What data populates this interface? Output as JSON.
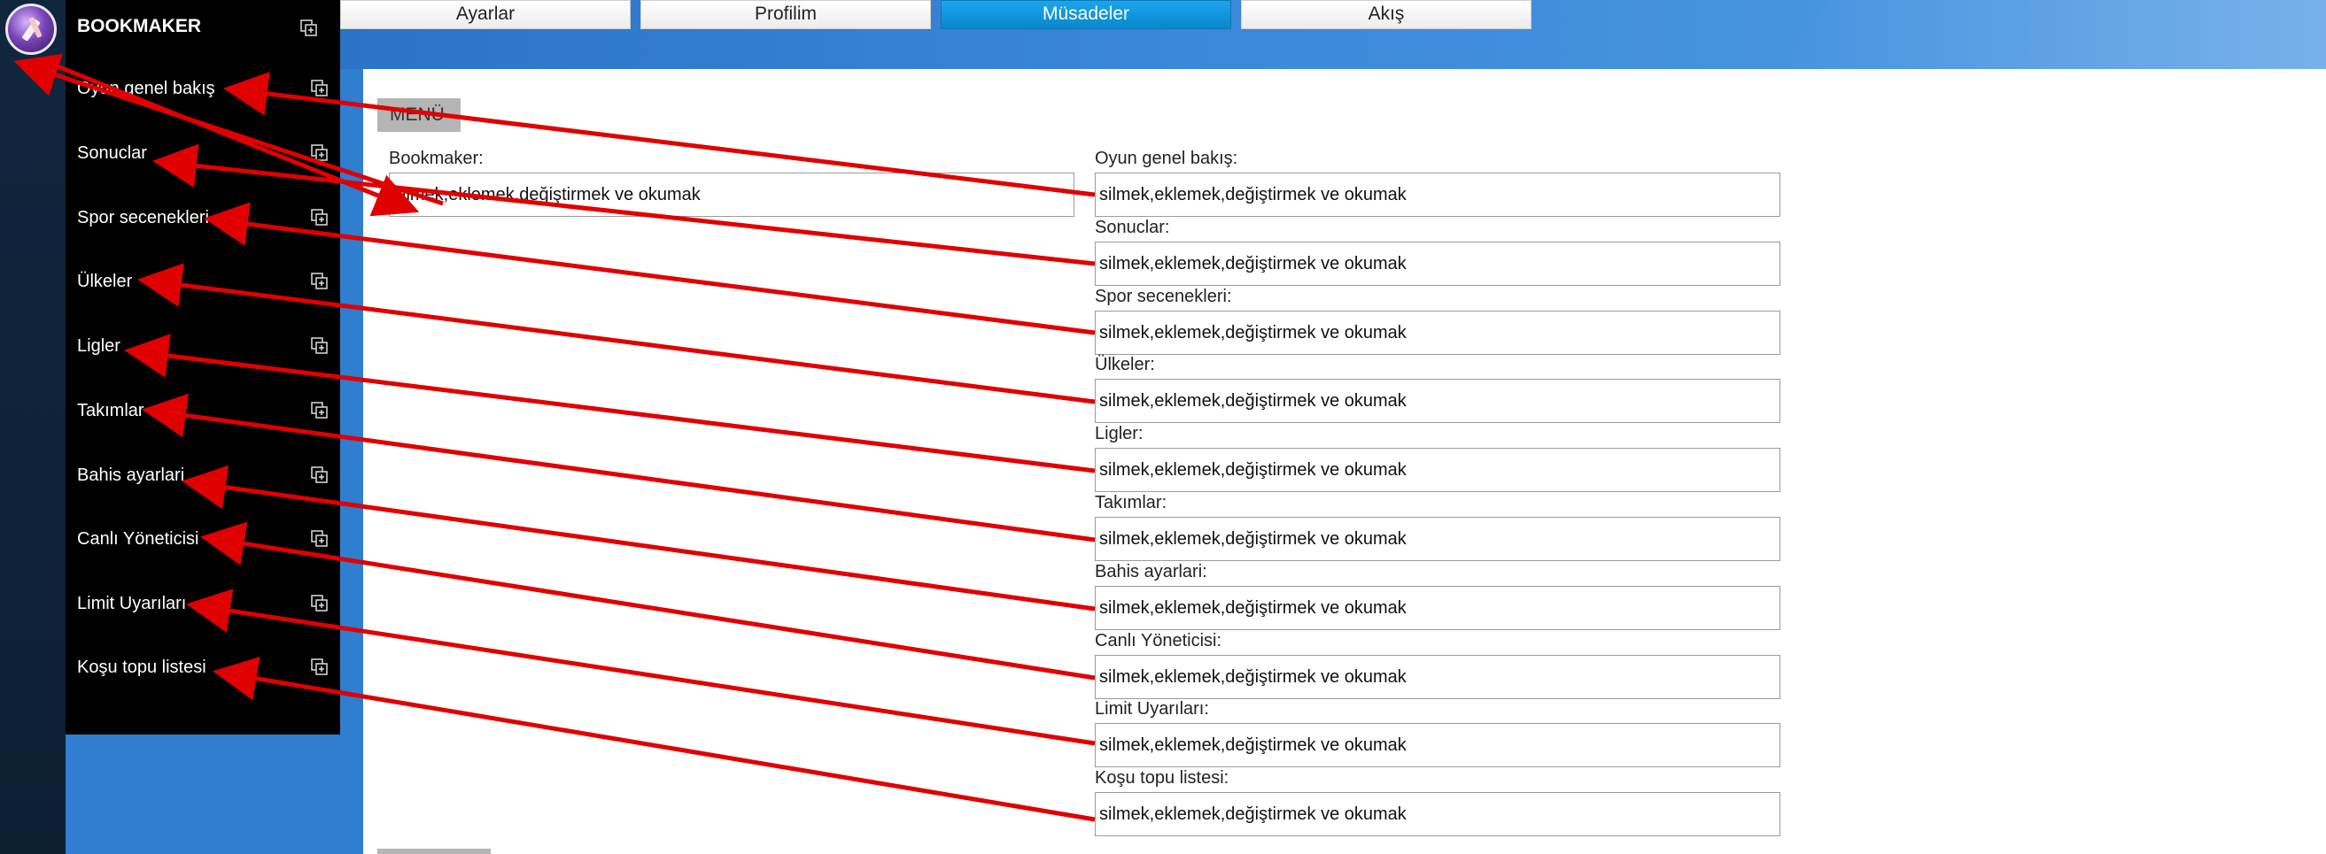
{
  "app": {
    "brand": "BOOKMAKER"
  },
  "sidebar": {
    "items": [
      {
        "label": "Oyun genel bakış"
      },
      {
        "label": "Sonuclar"
      },
      {
        "label": "Spor secenekleri"
      },
      {
        "label": "Ülkeler"
      },
      {
        "label": "Ligler"
      },
      {
        "label": "Takımlar"
      },
      {
        "label": "Bahis ayarlari"
      },
      {
        "label": "Canlı Yöneticisi"
      },
      {
        "label": "Limit Uyarıları"
      },
      {
        "label": "Koşu topu listesi"
      }
    ],
    "item_icon": "copy-add-icon"
  },
  "tabs": [
    {
      "label": "Ayarlar"
    },
    {
      "label": "Profilim"
    },
    {
      "label": "Müsadeler",
      "active": true
    },
    {
      "label": "Akış"
    }
  ],
  "panel": {
    "menu_label": "MENÜ",
    "left_field": {
      "label": "Bookmaker:",
      "value": "silmek,eklemek,değiştirmek ve okumak"
    },
    "fields": [
      {
        "label": "Oyun genel bakış:",
        "value": "silmek,eklemek,değiştirmek ve okumak"
      },
      {
        "label": "Sonuclar:",
        "value": "silmek,eklemek,değiştirmek ve okumak"
      },
      {
        "label": "Spor secenekleri:",
        "value": "silmek,eklemek,değiştirmek ve okumak"
      },
      {
        "label": "Ülkeler:",
        "value": "silmek,eklemek,değiştirmek ve okumak"
      },
      {
        "label": "Ligler:",
        "value": "silmek,eklemek,değiştirmek ve okumak"
      },
      {
        "label": "Takımlar:",
        "value": "silmek,eklemek,değiştirmek ve okumak"
      },
      {
        "label": "Bahis ayarlari:",
        "value": "silmek,eklemek,değiştirmek ve okumak"
      },
      {
        "label": "Canlı Yöneticisi:",
        "value": "silmek,eklemek,değiştirmek ve okumak"
      },
      {
        "label": "Limit Uyarıları:",
        "value": "silmek,eklemek,değiştirmek ve okumak"
      },
      {
        "label": "Koşu topu listesi:",
        "value": "silmek,eklemek,değiştirmek ve okumak"
      }
    ]
  },
  "colors": {
    "sidebar_bg": "#000000",
    "header_blue": "#2f7ed0",
    "active_tab": "#0b86cf",
    "annotation_arrow": "#e00000"
  }
}
